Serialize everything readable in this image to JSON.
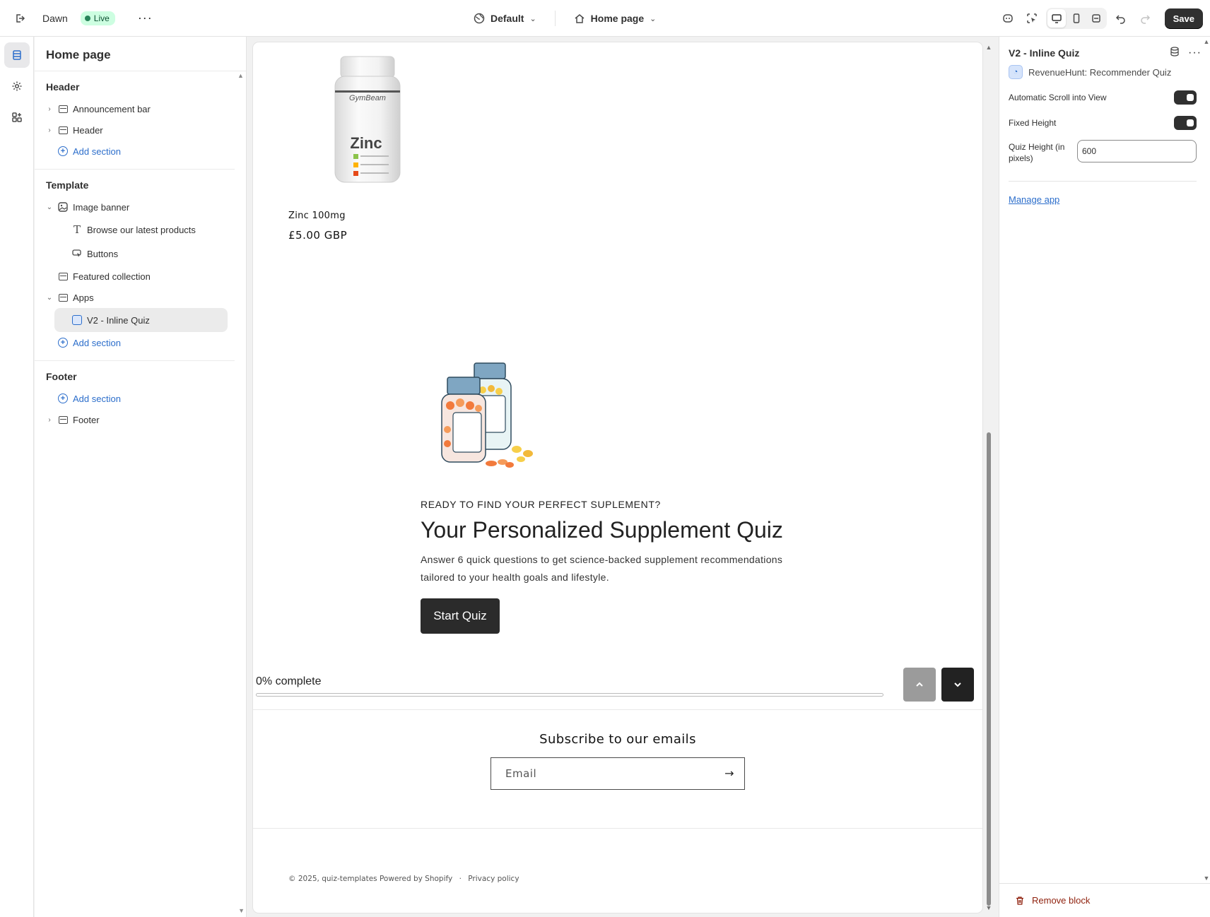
{
  "topbar": {
    "theme_name": "Dawn",
    "live_badge": "Live",
    "more_label": "···",
    "theme_select": "Default",
    "page_select": "Home page",
    "save_label": "Save"
  },
  "sidebar": {
    "title": "Home page",
    "groups": {
      "header": {
        "title": "Header",
        "items": [
          "Announcement bar",
          "Header"
        ],
        "add_label": "Add section"
      },
      "template": {
        "title": "Template",
        "image_banner": "Image banner",
        "image_banner_children": [
          "Browse our latest products",
          "Buttons"
        ],
        "featured": "Featured collection",
        "apps": "Apps",
        "apps_children": [
          "V2 - Inline Quiz"
        ],
        "add_label": "Add section"
      },
      "footer": {
        "title": "Footer",
        "add_label": "Add section",
        "items": [
          "Footer"
        ]
      }
    }
  },
  "canvas": {
    "product": {
      "brand_label": "GymBeam",
      "label_text": "Zinc",
      "name": "Zinc 100mg",
      "price": "£5.00 GBP"
    },
    "quiz": {
      "kicker": "READY TO FIND YOUR PERFECT SUPLEMENT?",
      "title": "Your Personalized Supplement Quiz",
      "description": "Answer 6 quick questions to get science-backed supplement recommendations tailored to your health goals and lifestyle.",
      "start_label": "Start Quiz",
      "progress_label": "0% complete",
      "progress_percent": 0
    },
    "newsletter": {
      "title": "Subscribe to our emails",
      "email_placeholder": "Email"
    },
    "footer": {
      "copyright": "© 2025, quiz-templates Powered by Shopify",
      "separator": "·",
      "privacy": "Privacy policy"
    }
  },
  "rpanel": {
    "title": "V2 - Inline Quiz",
    "app_name": "RevenueHunt: Recommender Quiz",
    "auto_scroll_label": "Automatic Scroll into View",
    "fixed_height_label": "Fixed Height",
    "quiz_height_label": "Quiz Height (in pixels)",
    "quiz_height_value": "600",
    "manage_label": "Manage app",
    "remove_label": "Remove block"
  },
  "colors": {
    "accent": "#2c6ecb",
    "live_bg": "#cdfee1",
    "save_bg": "#303030",
    "remove": "#8e1f0b"
  }
}
